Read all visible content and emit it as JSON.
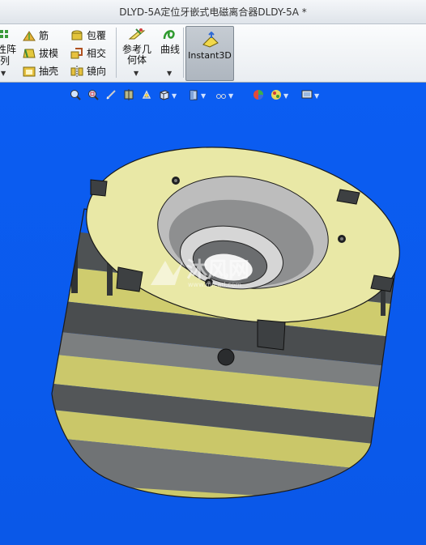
{
  "window": {
    "title": "DLYD-5A定位牙嵌式电磁离合器DLDY-5A *"
  },
  "ribbon": {
    "partial_label_top": "性阵",
    "partial_label_bottom": "列",
    "col1": [
      {
        "label": "筋",
        "icon": "rib-icon"
      },
      {
        "label": "拔模",
        "icon": "draft-icon"
      },
      {
        "label": "抽壳",
        "icon": "shell-icon"
      }
    ],
    "col2": [
      {
        "label": "包覆",
        "icon": "wrap-icon"
      },
      {
        "label": "相交",
        "icon": "intersect-icon"
      },
      {
        "label": "镜向",
        "icon": "mirror-icon"
      }
    ],
    "ref_geometry": {
      "line1": "参考几",
      "line2": "何体",
      "icon": "reference-geometry-icon"
    },
    "curves": {
      "label": "曲线",
      "icon": "curves-icon"
    },
    "instant3d": {
      "label": "Instant3D",
      "icon": "instant3d-icon",
      "active": true
    }
  },
  "view_toolbar": {
    "icons": [
      "zoom-to-fit-icon",
      "zoom-to-area-icon",
      "previous-view-icon",
      "section-view-icon",
      "dynamic-annotation-icon",
      "view-orientation-icon",
      "display-style-icon",
      "hide-show-icon",
      "edit-appearance-icon",
      "apply-scene-icon",
      "view-settings-icon"
    ]
  },
  "watermark": {
    "text": "沐风网",
    "url": "www.mfcad.com"
  },
  "colors": {
    "viewport": "#0a5cf0",
    "ring": "#e9e8a4",
    "body_yellow": "#cfcc6b",
    "body_gray": "#7a7c7d",
    "dark": "#4a4c4e"
  }
}
